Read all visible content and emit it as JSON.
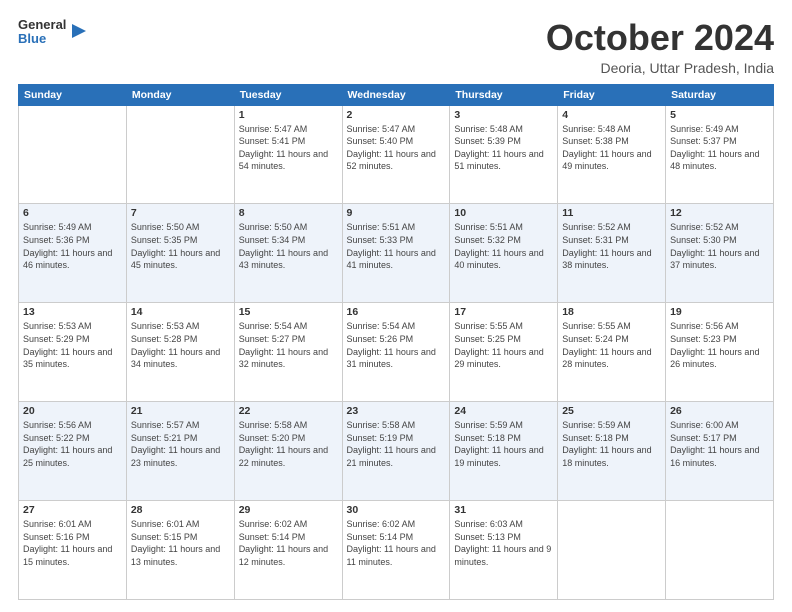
{
  "logo": {
    "general": "General",
    "blue": "Blue"
  },
  "title": "October 2024",
  "subtitle": "Deoria, Uttar Pradesh, India",
  "days": [
    "Sunday",
    "Monday",
    "Tuesday",
    "Wednesday",
    "Thursday",
    "Friday",
    "Saturday"
  ],
  "weeks": [
    [
      {
        "date": "",
        "info": ""
      },
      {
        "date": "",
        "info": ""
      },
      {
        "date": "1",
        "info": "Sunrise: 5:47 AM\nSunset: 5:41 PM\nDaylight: 11 hours and 54 minutes."
      },
      {
        "date": "2",
        "info": "Sunrise: 5:47 AM\nSunset: 5:40 PM\nDaylight: 11 hours and 52 minutes."
      },
      {
        "date": "3",
        "info": "Sunrise: 5:48 AM\nSunset: 5:39 PM\nDaylight: 11 hours and 51 minutes."
      },
      {
        "date": "4",
        "info": "Sunrise: 5:48 AM\nSunset: 5:38 PM\nDaylight: 11 hours and 49 minutes."
      },
      {
        "date": "5",
        "info": "Sunrise: 5:49 AM\nSunset: 5:37 PM\nDaylight: 11 hours and 48 minutes."
      }
    ],
    [
      {
        "date": "6",
        "info": "Sunrise: 5:49 AM\nSunset: 5:36 PM\nDaylight: 11 hours and 46 minutes."
      },
      {
        "date": "7",
        "info": "Sunrise: 5:50 AM\nSunset: 5:35 PM\nDaylight: 11 hours and 45 minutes."
      },
      {
        "date": "8",
        "info": "Sunrise: 5:50 AM\nSunset: 5:34 PM\nDaylight: 11 hours and 43 minutes."
      },
      {
        "date": "9",
        "info": "Sunrise: 5:51 AM\nSunset: 5:33 PM\nDaylight: 11 hours and 41 minutes."
      },
      {
        "date": "10",
        "info": "Sunrise: 5:51 AM\nSunset: 5:32 PM\nDaylight: 11 hours and 40 minutes."
      },
      {
        "date": "11",
        "info": "Sunrise: 5:52 AM\nSunset: 5:31 PM\nDaylight: 11 hours and 38 minutes."
      },
      {
        "date": "12",
        "info": "Sunrise: 5:52 AM\nSunset: 5:30 PM\nDaylight: 11 hours and 37 minutes."
      }
    ],
    [
      {
        "date": "13",
        "info": "Sunrise: 5:53 AM\nSunset: 5:29 PM\nDaylight: 11 hours and 35 minutes."
      },
      {
        "date": "14",
        "info": "Sunrise: 5:53 AM\nSunset: 5:28 PM\nDaylight: 11 hours and 34 minutes."
      },
      {
        "date": "15",
        "info": "Sunrise: 5:54 AM\nSunset: 5:27 PM\nDaylight: 11 hours and 32 minutes."
      },
      {
        "date": "16",
        "info": "Sunrise: 5:54 AM\nSunset: 5:26 PM\nDaylight: 11 hours and 31 minutes."
      },
      {
        "date": "17",
        "info": "Sunrise: 5:55 AM\nSunset: 5:25 PM\nDaylight: 11 hours and 29 minutes."
      },
      {
        "date": "18",
        "info": "Sunrise: 5:55 AM\nSunset: 5:24 PM\nDaylight: 11 hours and 28 minutes."
      },
      {
        "date": "19",
        "info": "Sunrise: 5:56 AM\nSunset: 5:23 PM\nDaylight: 11 hours and 26 minutes."
      }
    ],
    [
      {
        "date": "20",
        "info": "Sunrise: 5:56 AM\nSunset: 5:22 PM\nDaylight: 11 hours and 25 minutes."
      },
      {
        "date": "21",
        "info": "Sunrise: 5:57 AM\nSunset: 5:21 PM\nDaylight: 11 hours and 23 minutes."
      },
      {
        "date": "22",
        "info": "Sunrise: 5:58 AM\nSunset: 5:20 PM\nDaylight: 11 hours and 22 minutes."
      },
      {
        "date": "23",
        "info": "Sunrise: 5:58 AM\nSunset: 5:19 PM\nDaylight: 11 hours and 21 minutes."
      },
      {
        "date": "24",
        "info": "Sunrise: 5:59 AM\nSunset: 5:18 PM\nDaylight: 11 hours and 19 minutes."
      },
      {
        "date": "25",
        "info": "Sunrise: 5:59 AM\nSunset: 5:18 PM\nDaylight: 11 hours and 18 minutes."
      },
      {
        "date": "26",
        "info": "Sunrise: 6:00 AM\nSunset: 5:17 PM\nDaylight: 11 hours and 16 minutes."
      }
    ],
    [
      {
        "date": "27",
        "info": "Sunrise: 6:01 AM\nSunset: 5:16 PM\nDaylight: 11 hours and 15 minutes."
      },
      {
        "date": "28",
        "info": "Sunrise: 6:01 AM\nSunset: 5:15 PM\nDaylight: 11 hours and 13 minutes."
      },
      {
        "date": "29",
        "info": "Sunrise: 6:02 AM\nSunset: 5:14 PM\nDaylight: 11 hours and 12 minutes."
      },
      {
        "date": "30",
        "info": "Sunrise: 6:02 AM\nSunset: 5:14 PM\nDaylight: 11 hours and 11 minutes."
      },
      {
        "date": "31",
        "info": "Sunrise: 6:03 AM\nSunset: 5:13 PM\nDaylight: 11 hours and 9 minutes."
      },
      {
        "date": "",
        "info": ""
      },
      {
        "date": "",
        "info": ""
      }
    ]
  ]
}
